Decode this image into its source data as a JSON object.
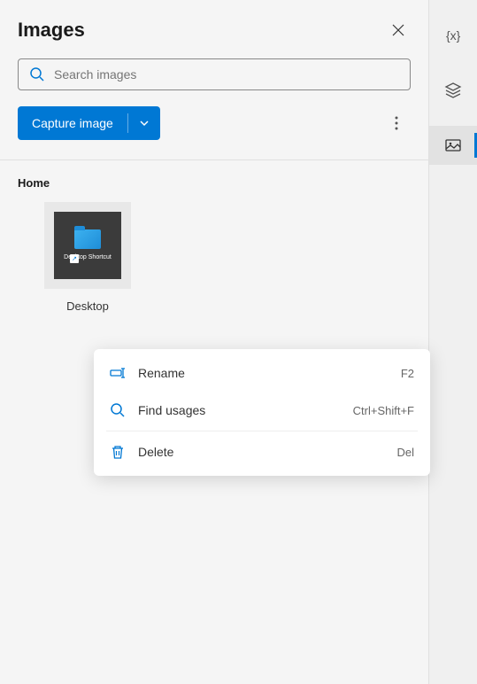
{
  "panel": {
    "title": "Images"
  },
  "search": {
    "placeholder": "Search images"
  },
  "actions": {
    "capture_label": "Capture image"
  },
  "section": {
    "title": "Home"
  },
  "thumbnail": {
    "inner_label": "Desktop\nShortcut",
    "label": "Desktop"
  },
  "context_menu": {
    "items": [
      {
        "icon": "rename",
        "label": "Rename",
        "shortcut": "F2"
      },
      {
        "icon": "search",
        "label": "Find usages",
        "shortcut": "Ctrl+Shift+F"
      },
      {
        "icon": "trash",
        "label": "Delete",
        "shortcut": "Del"
      }
    ]
  },
  "rail": {
    "items": [
      {
        "name": "variables",
        "active": false
      },
      {
        "name": "layers",
        "active": false
      },
      {
        "name": "images",
        "active": true
      }
    ]
  }
}
